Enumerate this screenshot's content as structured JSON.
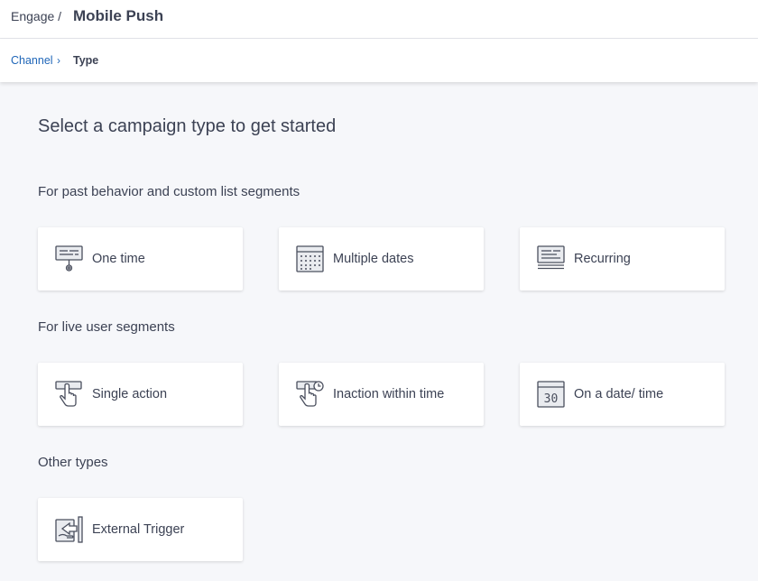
{
  "header": {
    "breadcrumb_root": "Engage /",
    "title": "Mobile Push"
  },
  "steps": {
    "previous": "Channel",
    "current": "Type"
  },
  "main": {
    "heading": "Select a campaign type to get started"
  },
  "sections": [
    {
      "label": "For past behavior and custom list segments",
      "cards": [
        {
          "label": "One time",
          "icon": "single-message-icon"
        },
        {
          "label": "Multiple dates",
          "icon": "calendar-grid-icon"
        },
        {
          "label": "Recurring",
          "icon": "stacked-messages-icon"
        }
      ]
    },
    {
      "label": "For live user segments",
      "cards": [
        {
          "label": "Single action",
          "icon": "tap-hand-icon"
        },
        {
          "label": "Inaction within time",
          "icon": "tap-hand-clock-icon"
        },
        {
          "label": "On a date/ time",
          "icon": "calendar-date-icon",
          "icon_text": "30"
        }
      ]
    },
    {
      "label": "Other types",
      "cards": [
        {
          "label": "External Trigger",
          "icon": "external-trigger-icon"
        }
      ]
    }
  ],
  "colors": {
    "background": "#f6f7fa",
    "link": "#1f66b8",
    "text": "#3c4254",
    "icon_stroke": "#4a4f5e"
  }
}
